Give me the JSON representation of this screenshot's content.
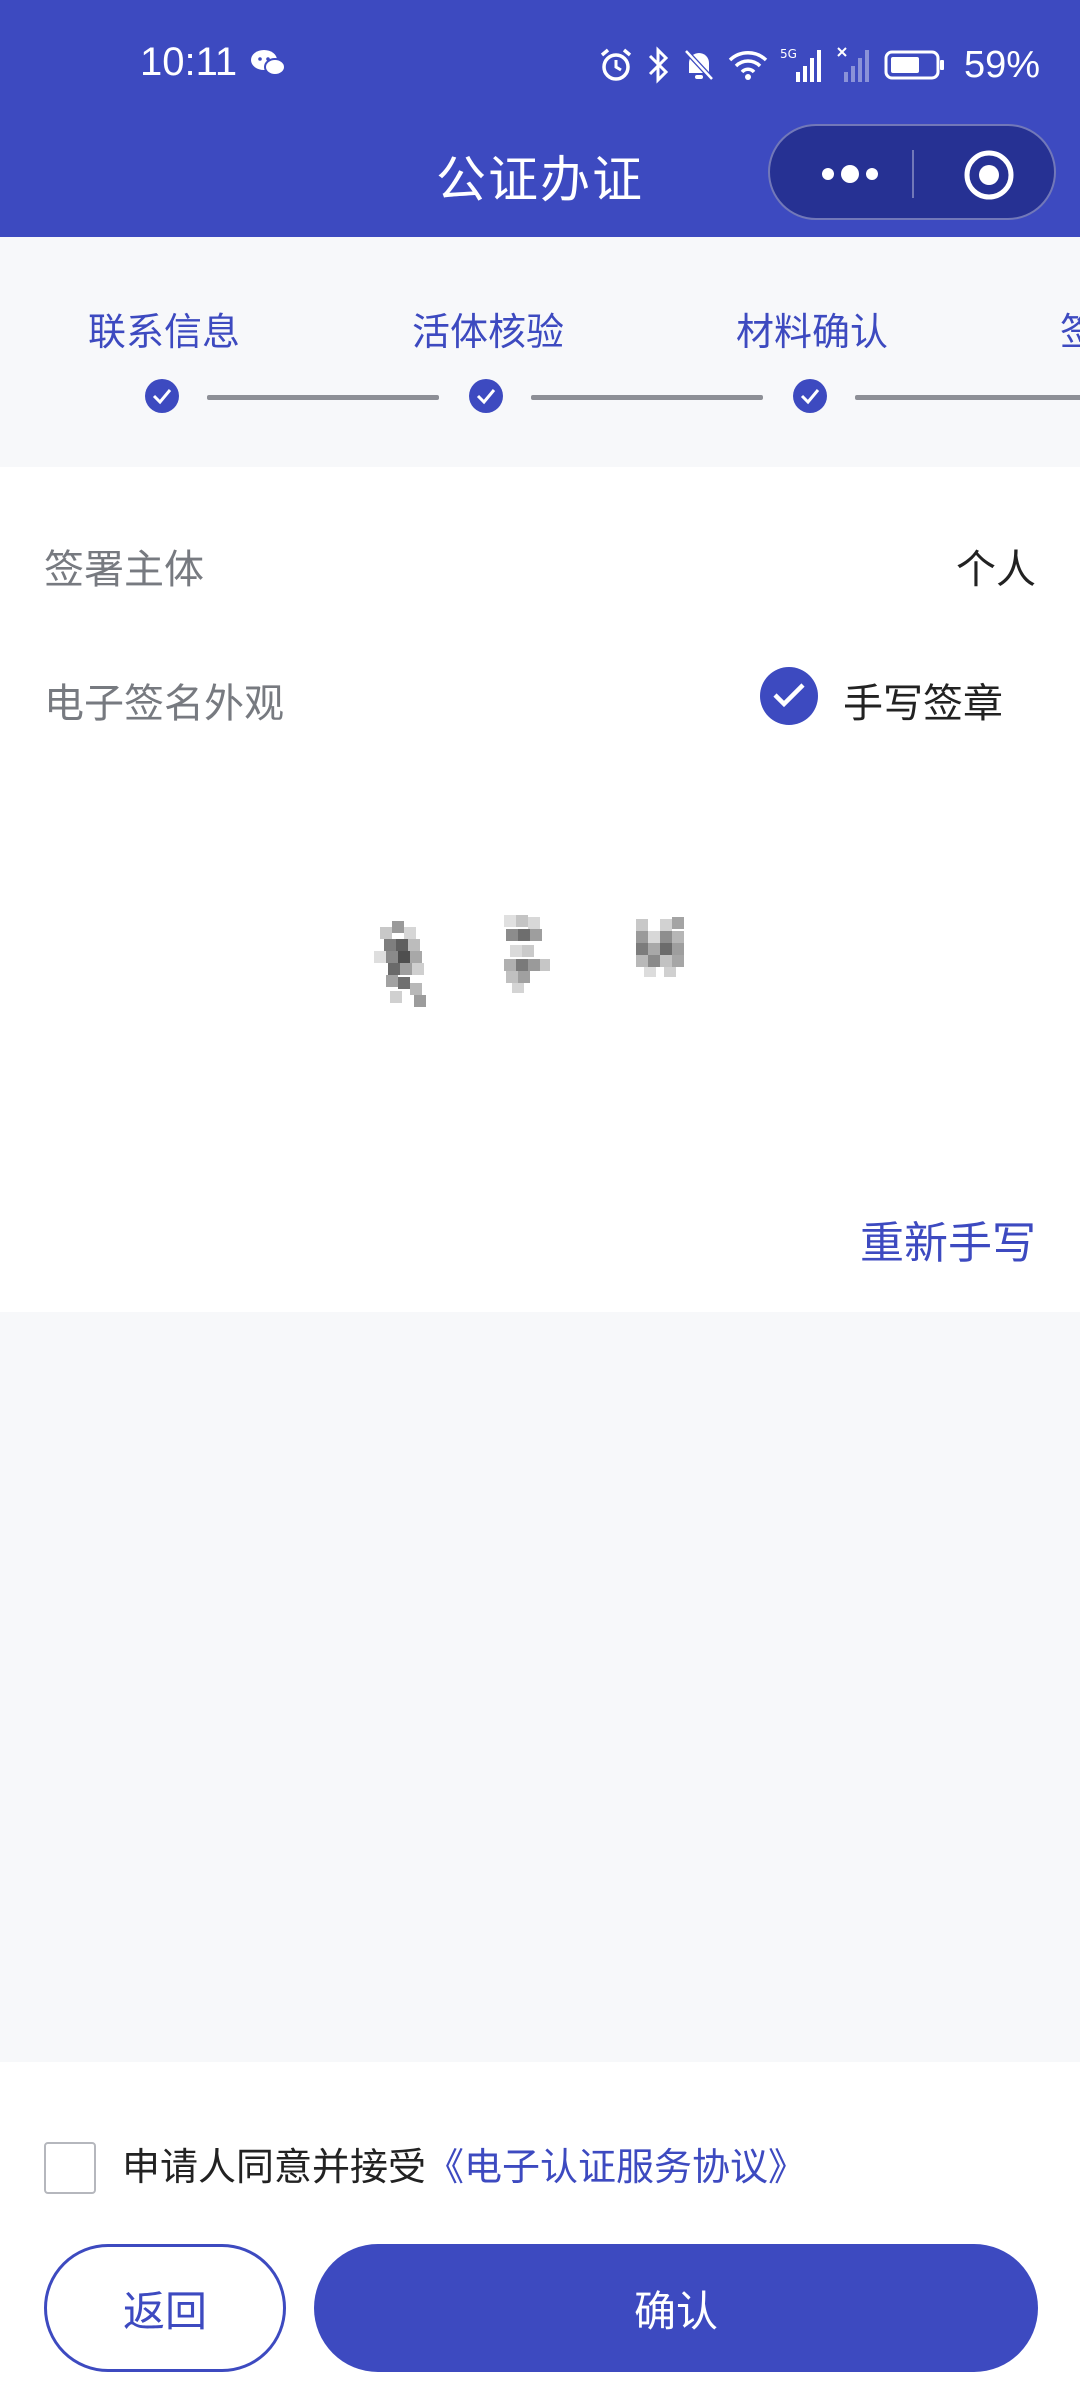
{
  "status_bar": {
    "time": "10:11",
    "battery": "59%",
    "network": "5G",
    "icons": [
      "wechat-icon",
      "alarm-icon",
      "bluetooth-icon",
      "mute-icon",
      "wifi-icon",
      "signal-icon",
      "battery-icon"
    ]
  },
  "nav": {
    "title": "公证办证",
    "capsule_icons": [
      "more-icon",
      "close-target-icon"
    ]
  },
  "steps": [
    {
      "label": "联系信息",
      "done": true
    },
    {
      "label": "活体核验",
      "done": true
    },
    {
      "label": "材料确认",
      "done": true
    },
    {
      "label": "签",
      "done": false
    }
  ],
  "form": {
    "signer_label": "签署主体",
    "signer_value": "个人",
    "appearance_label": "电子签名外观",
    "appearance_option": "手写签章",
    "appearance_checked": true,
    "rewrite_label": "重新手写"
  },
  "agreement": {
    "prefix": "申请人同意并接受",
    "link": "《电子认证服务协议》",
    "checked": false
  },
  "buttons": {
    "back": "返回",
    "confirm": "确认"
  },
  "colors": {
    "primary": "#3d4ac0",
    "background": "#f7f8fa",
    "line": "#8d8f96"
  }
}
